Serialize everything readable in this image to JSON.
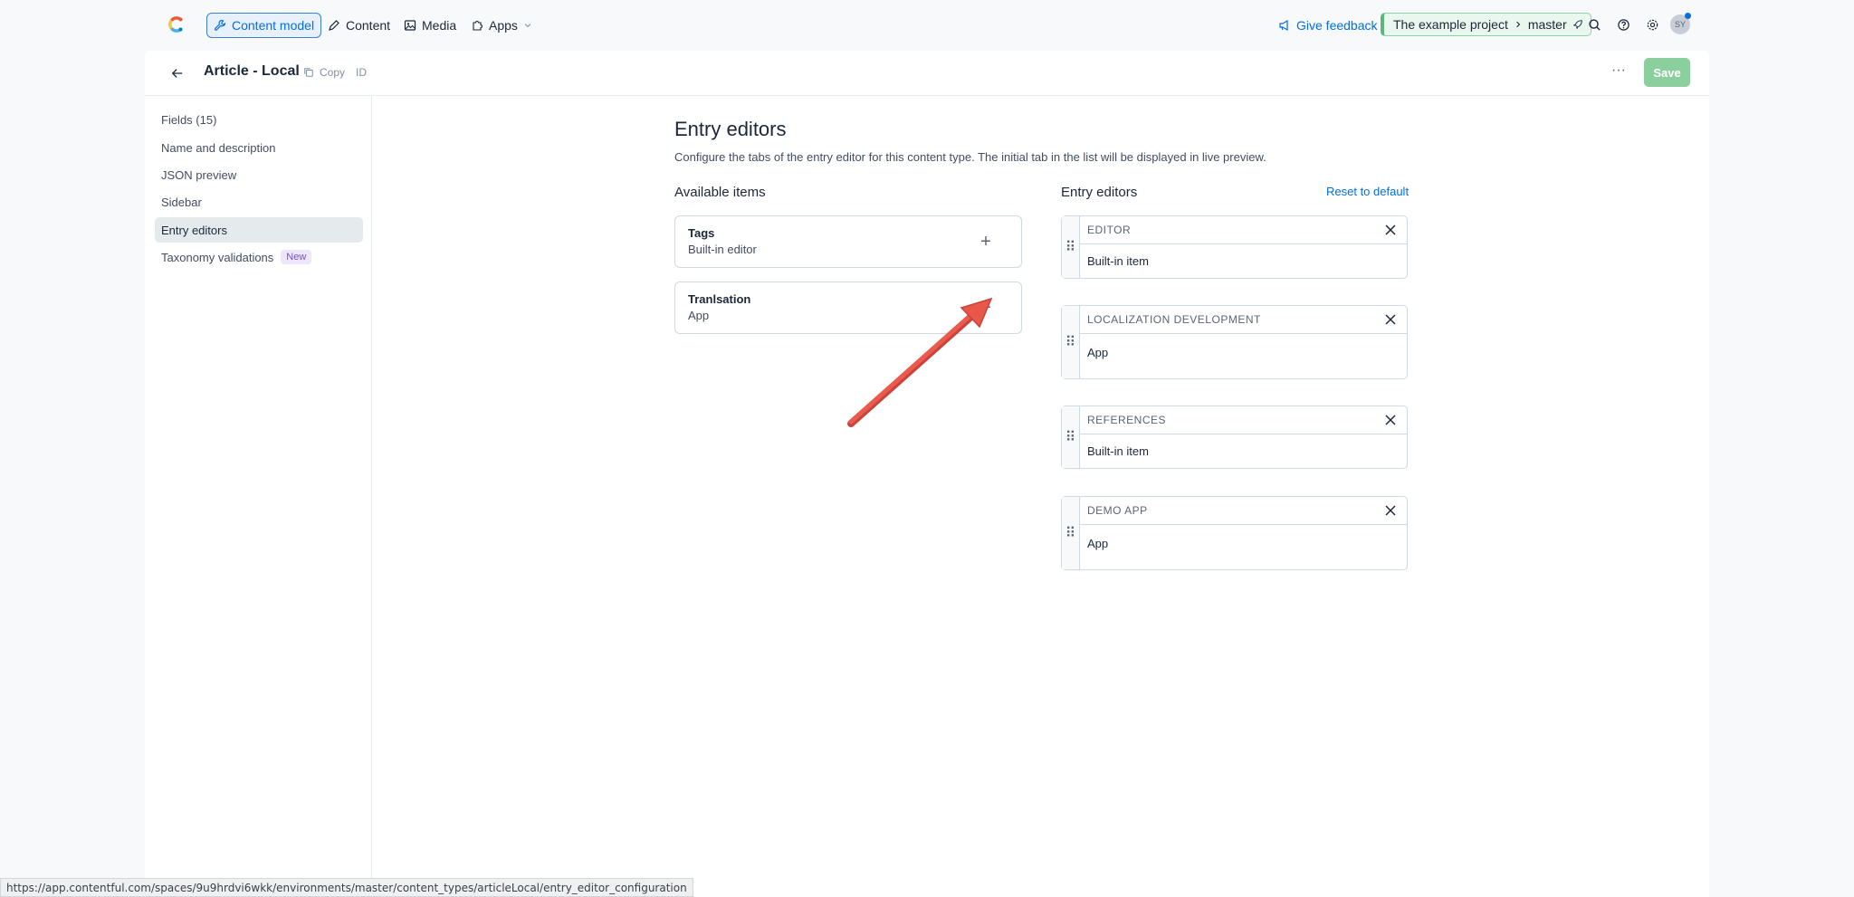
{
  "topnav": {
    "tabs": [
      {
        "label": "Content model",
        "icon": "wrench-icon",
        "active": true
      },
      {
        "label": "Content",
        "icon": "pen-icon"
      },
      {
        "label": "Media",
        "icon": "image-icon"
      },
      {
        "label": "Apps",
        "icon": "puzzle-icon"
      }
    ],
    "feedback_label": "Give feedback",
    "project_label": "The example project",
    "environment_label": "master",
    "avatar_initials": "SY"
  },
  "header": {
    "title": "Article - Local",
    "copy_label": "Copy",
    "id_label": "ID",
    "more_label": "···",
    "save_label": "Save"
  },
  "sidebar": {
    "items": [
      {
        "label": "Fields (15)"
      },
      {
        "label": "Name and description"
      },
      {
        "label": "JSON preview"
      },
      {
        "label": "Sidebar"
      },
      {
        "label": "Entry editors",
        "active": true
      },
      {
        "label": "Taxonomy validations",
        "badge": "New"
      }
    ]
  },
  "main": {
    "title": "Entry editors",
    "description": "Configure the tabs of the entry editor for this content type. The initial tab in the list will be displayed in live preview.",
    "available_title": "Available items",
    "editors_title": "Entry editors",
    "reset_label": "Reset to default",
    "available_items": [
      {
        "name": "Tags",
        "type": "Built-in editor"
      },
      {
        "name": "Tranlsation",
        "type": "App"
      }
    ],
    "entry_editors": [
      {
        "name": "EDITOR",
        "type": "Built-in item"
      },
      {
        "name": "LOCALIZATION DEVELOPMENT",
        "type": "App"
      },
      {
        "name": "REFERENCES",
        "type": "Built-in item"
      },
      {
        "name": "DEMO APP",
        "type": "App"
      }
    ]
  },
  "statusbar": {
    "url": "https://app.contentful.com/spaces/9u9hrdvi6wkk/environments/master/content_types/articleLocal/entry_editor_configuration"
  },
  "colors": {
    "accent": "#036fe3",
    "save": "#8ccf9e",
    "annotation_arrow": "#e8574a"
  }
}
